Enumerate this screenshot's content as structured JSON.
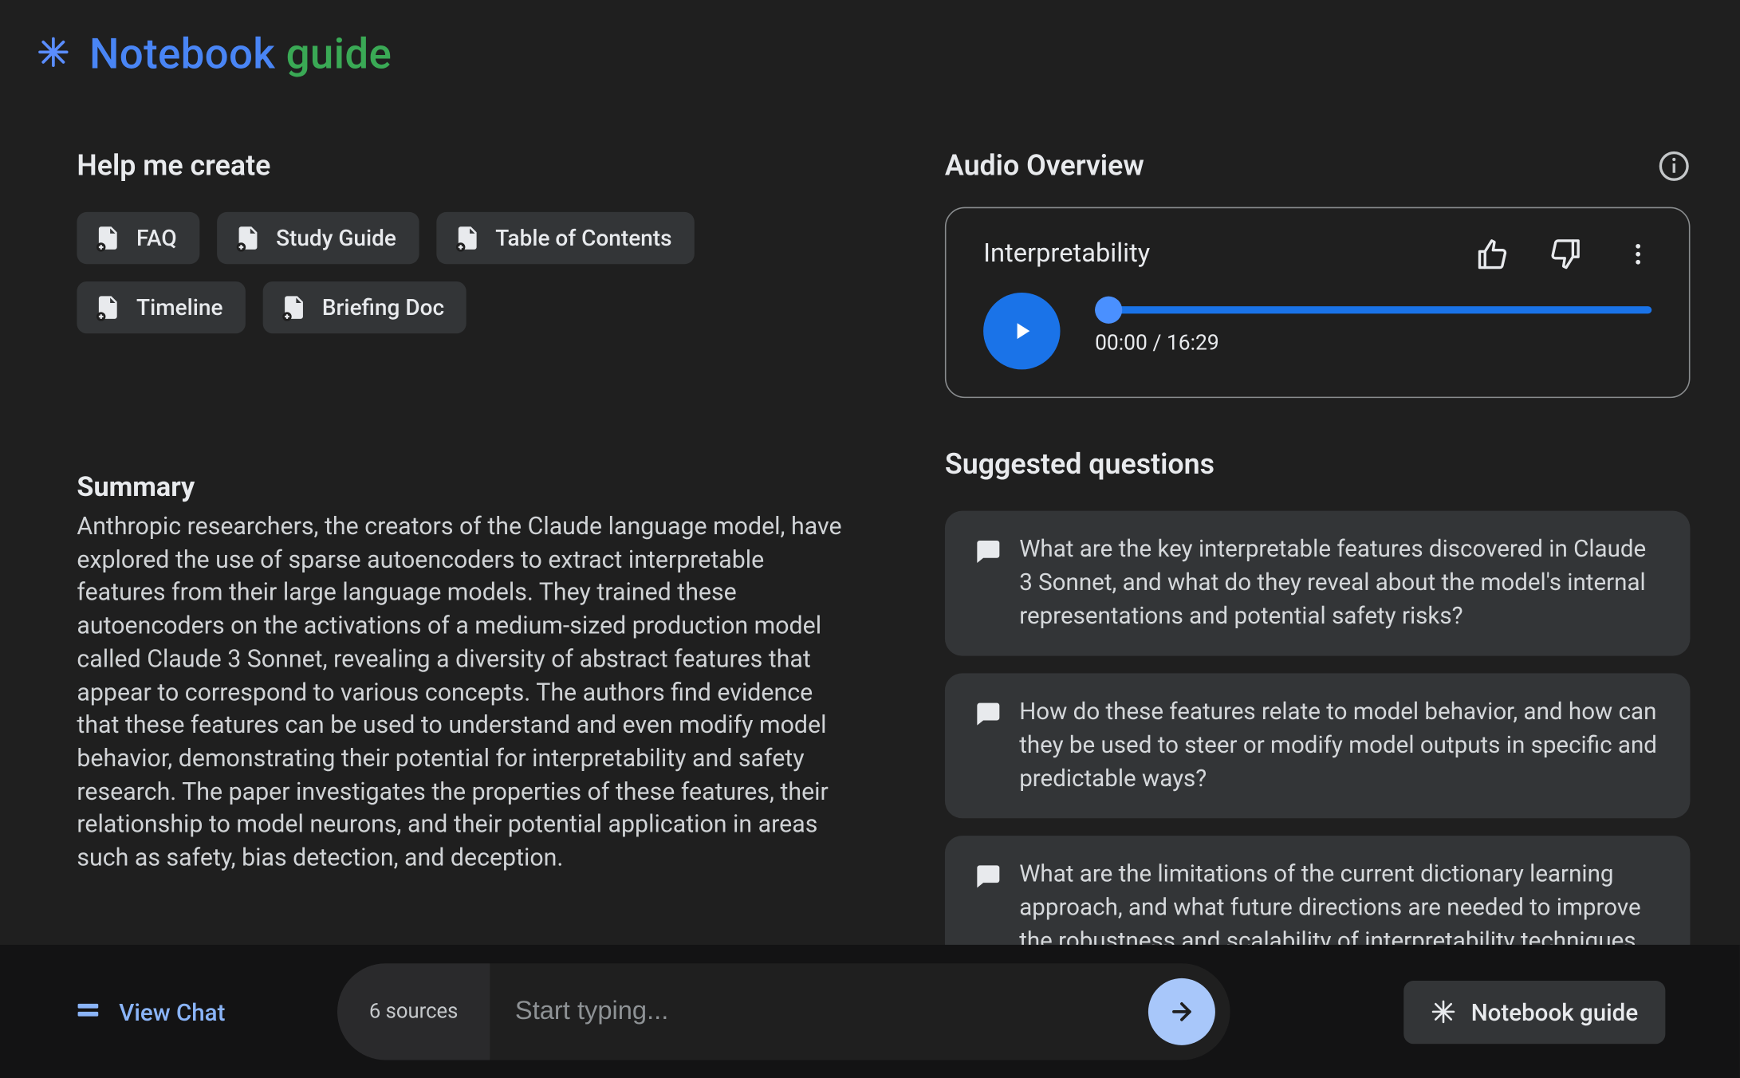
{
  "header": {
    "title_a": "Notebook ",
    "title_b": "guide"
  },
  "left": {
    "help_title": "Help me create",
    "chips": [
      "FAQ",
      "Study Guide",
      "Table of Contents",
      "Timeline",
      "Briefing Doc"
    ],
    "summary_title": "Summary",
    "summary_body": "Anthropic researchers, the creators of the Claude language model, have explored the use of sparse autoencoders to extract interpretable features from their large language models. They trained these autoencoders on the activations of a medium-sized production model called Claude 3 Sonnet, revealing a diversity of abstract features that appear to correspond to various concepts. The authors find evidence that these features can be used to understand and even modify model behavior, demonstrating their potential for interpretability and safety research. The paper investigates the properties of these features, their relationship to model neurons, and their potential application in areas such as safety, bias detection, and deception."
  },
  "right": {
    "audio_title": "Audio Overview",
    "player": {
      "title": "Interpretability",
      "time_current": "00:00",
      "time_total": "16:29"
    },
    "suggested_title": "Suggested questions",
    "suggestions": [
      "What are the key interpretable features discovered in Claude 3 Sonnet, and what do they reveal about the model's internal representations and potential safety risks?",
      "How do these features relate to model behavior, and how can they be used to steer or modify model outputs in specific and predictable ways?",
      "What are the limitations of the current dictionary learning approach, and what future directions are needed to improve the robustness and scalability of interpretability techniques for large language"
    ]
  },
  "bottom": {
    "view_chat": "View Chat",
    "sources_label": "6 sources",
    "placeholder": "Start typing...",
    "guide_button": "Notebook guide"
  }
}
